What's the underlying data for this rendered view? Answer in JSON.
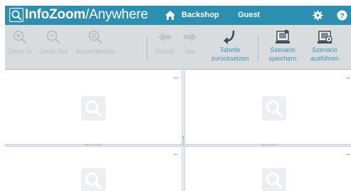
{
  "header": {
    "brand_bold": "InfoZoom",
    "brand_light": "/Anywhere",
    "location": "Backshop",
    "user": "Guest",
    "bg_color": "#2d8fb0"
  },
  "toolbar": {
    "zoom_in": "Zoom In",
    "zoom_out": "Zoom Out",
    "exclude": "Ausschließen",
    "back": "Zurück",
    "forward": "Vor",
    "reset_table_1": "Tabelle",
    "reset_table_2": "zurücksetzen",
    "save_scenario_1": "Szenario",
    "save_scenario_2": "speichern",
    "run_scenario_1": "Szenario",
    "run_scenario_2": "ausführen",
    "active_color": "#4a8fb3",
    "disabled_color": "#b7babd"
  },
  "panes": {
    "menu_glyph": "..."
  },
  "icons": [
    "logo-search-icon",
    "home-icon",
    "gear-icon",
    "help-icon",
    "zoom-in-icon",
    "zoom-out-icon",
    "exclude-icon",
    "arrow-left-icon",
    "arrow-right-icon",
    "reset-table-icon",
    "save-scenario-icon",
    "run-scenario-icon",
    "placeholder-search-icon"
  ]
}
